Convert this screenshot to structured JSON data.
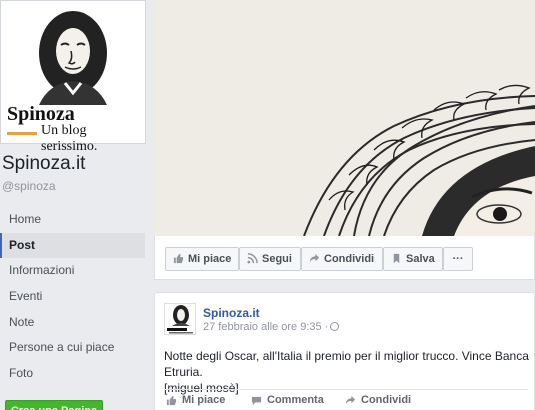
{
  "page": {
    "logo_word": "Spinoza",
    "logo_tagline": "Un blog serissimo.",
    "name": "Spinoza.it",
    "handle": "@spinoza"
  },
  "nav": {
    "items": [
      {
        "label": "Home",
        "active": false
      },
      {
        "label": "Post",
        "active": true
      },
      {
        "label": "Informazioni",
        "active": false
      },
      {
        "label": "Eventi",
        "active": false
      },
      {
        "label": "Note",
        "active": false
      },
      {
        "label": "Persone a cui piace",
        "active": false
      },
      {
        "label": "Foto",
        "active": false
      }
    ],
    "create_page_label": "Crea una Pagina"
  },
  "actions": {
    "like": "Mi piace",
    "follow": "Segui",
    "share": "Condividi",
    "save": "Salva",
    "more": "···"
  },
  "post": {
    "author": "Spinoza.it",
    "time": "27 febbraio alle ore 9:35 ·",
    "text_line1": "Notte degli Oscar, all'Italia il premio per il miglior trucco. Vince Banca Etruria.",
    "text_line2": "[miguel mosè]",
    "like": "Mi piace",
    "comment": "Commenta",
    "share": "Condividi"
  },
  "icons": {
    "like": "thumbs-up-icon",
    "follow": "rss-icon",
    "share": "share-arrow-icon",
    "save": "bookmark-icon",
    "privacy": "globe-icon"
  },
  "colors": {
    "link": "#365899",
    "accent": "#4267b2",
    "create_button": "#42b72a",
    "logo_underline": "#e8a13c"
  }
}
